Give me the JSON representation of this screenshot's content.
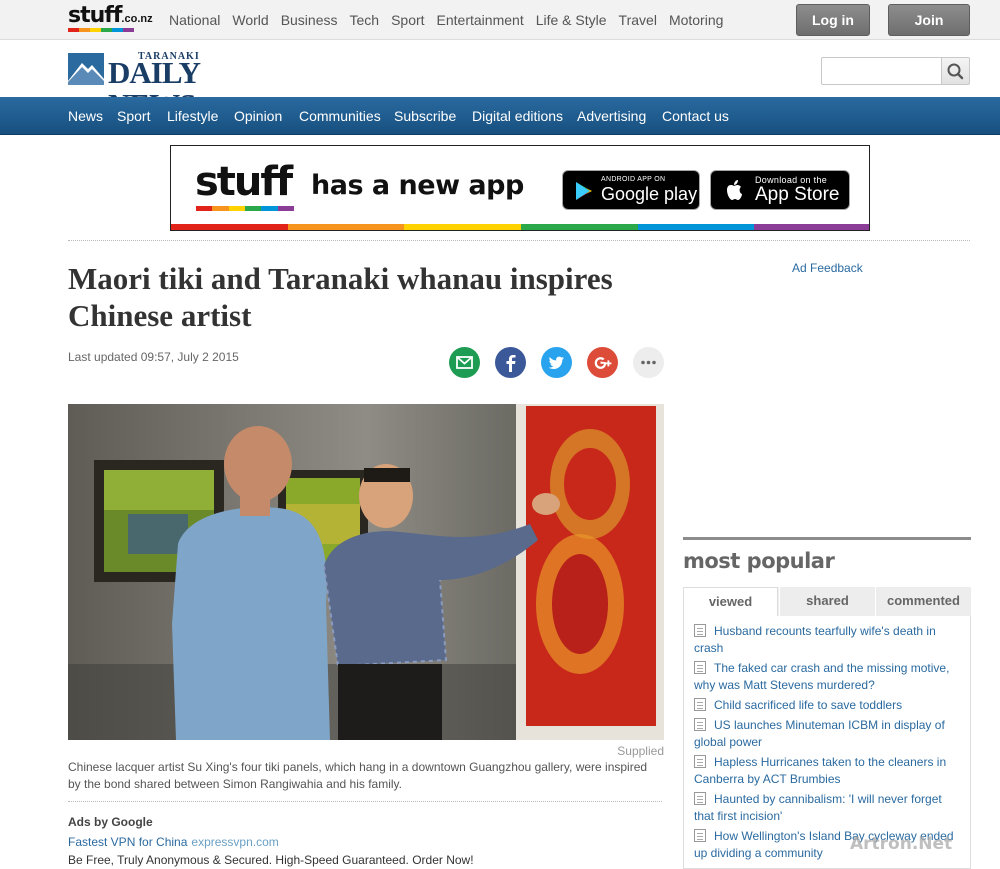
{
  "topbar": {
    "logo_word": "stuff",
    "logo_tld": ".co.nz",
    "nav": [
      "National",
      "World",
      "Business",
      "Tech",
      "Sport",
      "Entertainment",
      "Life & Style",
      "Travel",
      "Motoring"
    ],
    "login_label": "Log in",
    "join_label": "Join"
  },
  "masthead": {
    "logo_small": "TARANAKI",
    "logo_big": "DAILY NEWS",
    "search_placeholder": ""
  },
  "main_nav": [
    "News",
    "Sport",
    "Lifestyle",
    "Opinion",
    "Communities",
    "Subscribe",
    "Digital editions",
    "Advertising",
    "Contact us"
  ],
  "banner": {
    "logo": "stuff",
    "text": "has a new app",
    "google_small": "ANDROID APP ON",
    "google_large": "Google play",
    "apple_small": "Download on the",
    "apple_large": "App Store"
  },
  "article": {
    "headline": "Maori tiki and Taranaki whanau inspires Chinese artist",
    "updated": "Last updated 09:57, July 2 2015",
    "photo_credit": "Supplied",
    "caption": "Chinese lacquer artist Su Xing's four tiki panels, which hang in a downtown Guangzhou gallery, were inspired by the bond shared between Simon Rangiwahia and his family."
  },
  "ad_feedback": "Ad Feedback",
  "ads": {
    "title": "Ads by Google",
    "ad_title": "Fastest VPN for China",
    "ad_url": "expressvpn.com",
    "ad_body": "Be Free, Truly Anonymous & Secured. High-Speed Guaranteed. Order Now!"
  },
  "most_popular": {
    "title": "most popular",
    "tabs": [
      "viewed",
      "shared",
      "commented"
    ],
    "active_tab": "viewed",
    "items": [
      "Husband recounts tearfully wife's death in crash",
      "The faked car crash and the missing motive, why was Matt Stevens murdered?",
      "Child sacrificed life to save toddlers",
      "US launches Minuteman ICBM in display of global power",
      "Hapless Hurricanes taken to the cleaners in Canberra by ACT Brumbies",
      "Haunted by cannibalism: 'I will never forget that first incision'",
      "How Wellington's Island Bay cycleway ended up dividing a community"
    ]
  },
  "watermark": "Artron.Net",
  "colors": {
    "brand_blue": "#1a5a8e",
    "link_blue": "#2a6aa0",
    "rainbow": [
      "#e2231a",
      "#f7941d",
      "#ffd200",
      "#2aa84a",
      "#0094d9",
      "#8a3c96"
    ]
  },
  "icons": [
    "search-icon",
    "email-icon",
    "facebook-icon",
    "twitter-icon",
    "googleplus-icon",
    "more-icon",
    "google-play-icon",
    "apple-icon",
    "document-icon"
  ]
}
